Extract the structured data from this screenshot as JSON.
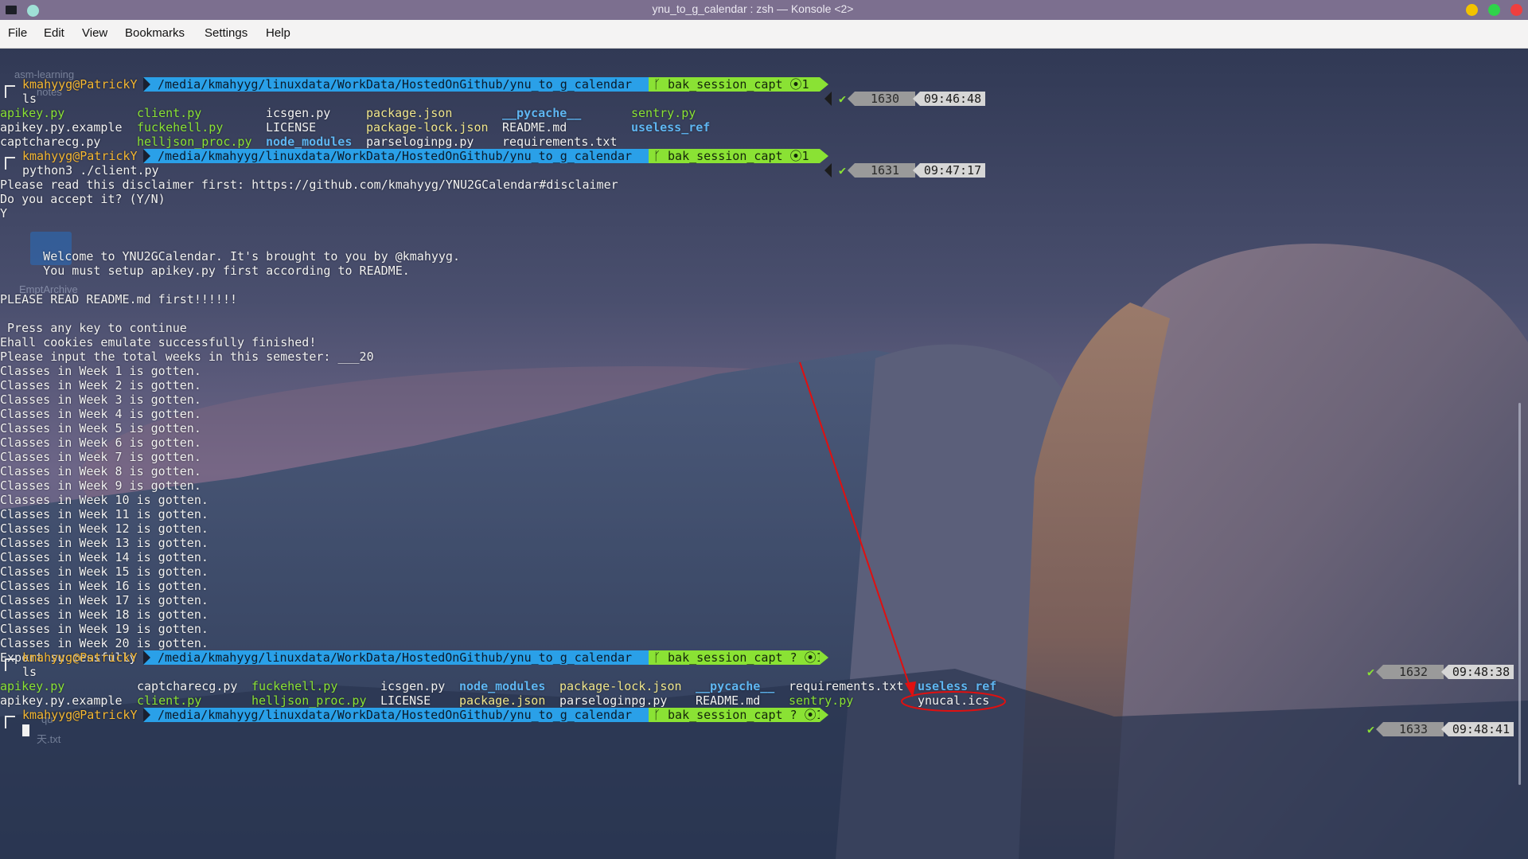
{
  "window": {
    "title": "ynu_to_g_calendar : zsh — Konsole <2>"
  },
  "menu": [
    "File",
    "Edit",
    "View",
    "Bookmarks",
    "Settings",
    "Help"
  ],
  "desktop_icons": [
    "asm-learning",
    "notes",
    "EmptArchive",
    "qu",
    "天.txt"
  ],
  "prompt": {
    "user": "kmahyyg@PatrickY",
    "path": "/media/kmahyyg/linuxdata/WorkData/HostedOnGithub/ynu_to_g_calendar",
    "git1": "ᚴ bak_session_capt ⦿1",
    "git2": "ᚴ bak_session_capt ? ⦿1"
  },
  "rprompts": [
    {
      "num": "1630",
      "time": "09:46:48"
    },
    {
      "num": "1631",
      "time": "09:47:17"
    },
    {
      "num": "1632",
      "time": "09:48:38"
    },
    {
      "num": "1633",
      "time": "09:48:41"
    }
  ],
  "check": "✔",
  "commands": {
    "ls": "ls",
    "run": "python3 ./client.py"
  },
  "ls1": [
    [
      "apikey.py",
      "client.py",
      "icsgen.py",
      "package.json",
      "__pycache__",
      "sentry.py"
    ],
    [
      "apikey.py.example",
      "fuckehell.py",
      "LICENSE",
      "package-lock.json",
      "README.md",
      "useless_ref"
    ],
    [
      "captcharecg.py",
      "helljson_proc.py",
      "node_modules",
      "parseloginpg.py",
      "requirements.txt"
    ]
  ],
  "output": [
    "Please read this disclaimer first: https://github.com/kmahyyg/YNU2GCalendar#disclaimer",
    "Do you accept it? (Y/N)",
    "Y",
    "",
    "",
    "      Welcome to YNU2GCalendar. It's brought to you by @kmahyyg.",
    "      You must setup apikey.py first according to README.",
    "",
    "PLEASE READ README.md first!!!!!!",
    "",
    " Press any key to continue",
    "Ehall cookies emulate successfully finished!",
    "Please input the total weeks in this semester: ___20",
    "Classes in Week 1 is gotten.",
    "Classes in Week 2 is gotten.",
    "Classes in Week 3 is gotten.",
    "Classes in Week 4 is gotten.",
    "Classes in Week 5 is gotten.",
    "Classes in Week 6 is gotten.",
    "Classes in Week 7 is gotten.",
    "Classes in Week 8 is gotten.",
    "Classes in Week 9 is gotten.",
    "Classes in Week 10 is gotten.",
    "Classes in Week 11 is gotten.",
    "Classes in Week 12 is gotten.",
    "Classes in Week 13 is gotten.",
    "Classes in Week 14 is gotten.",
    "Classes in Week 15 is gotten.",
    "Classes in Week 16 is gotten.",
    "Classes in Week 17 is gotten.",
    "Classes in Week 18 is gotten.",
    "Classes in Week 19 is gotten.",
    "Classes in Week 20 is gotten.",
    "Export successfully finished."
  ],
  "ls2": [
    [
      "apikey.py",
      "captcharecg.py",
      "fuckehell.py",
      "icsgen.py",
      "node_modules",
      "package-lock.json",
      "__pycache__",
      "requirements.txt",
      "useless_ref"
    ],
    [
      "apikey.py.example",
      "client.py",
      "helljson_proc.py",
      "LICENSE",
      "package.json",
      "parseloginpg.py",
      "README.md",
      "sentry.py",
      "ynucal.ics"
    ]
  ],
  "colors": {
    "executable": "#8ae234",
    "directory": "#5fb6f2",
    "package": "#f0e68c",
    "annotation": "#e01010"
  }
}
